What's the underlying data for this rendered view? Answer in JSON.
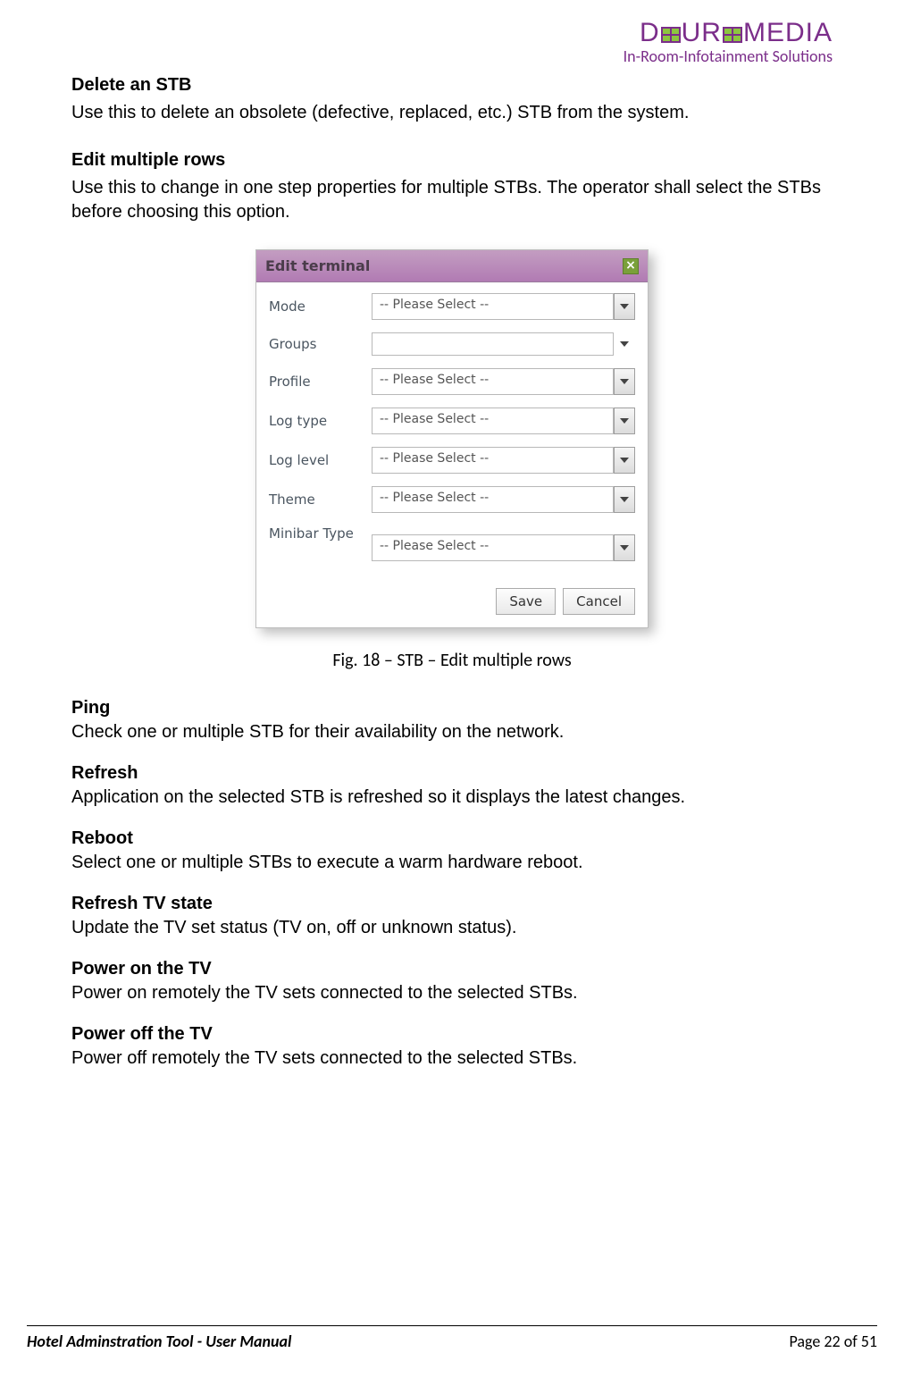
{
  "brand": {
    "name_1": "D",
    "name_2": "UR",
    "name_3": "MEDIA",
    "tagline": "In-Room-Infotainment Solutions"
  },
  "sections_top": [
    {
      "heading": "Delete an STB",
      "body": "Use this to delete an obsolete (defective, replaced, etc.) STB from the system."
    },
    {
      "heading": "Edit multiple rows",
      "body": "Use this to change in one step properties for multiple STBs. The operator shall select the STBs before choosing this option."
    }
  ],
  "dialog": {
    "title": "Edit terminal",
    "close_glyph": "×",
    "rows": [
      {
        "label": "Mode",
        "value": "-- Please Select --",
        "style": "select"
      },
      {
        "label": "Groups",
        "value": "",
        "style": "combo"
      },
      {
        "label": "Profile",
        "value": "-- Please Select --",
        "style": "select"
      },
      {
        "label": "Log type",
        "value": "-- Please Select --",
        "style": "select"
      },
      {
        "label": "Log level",
        "value": "-- Please Select --",
        "style": "select"
      },
      {
        "label": "Theme",
        "value": "-- Please Select --",
        "style": "select"
      },
      {
        "label": "Minibar Type",
        "value": "-- Please Select --",
        "style": "select",
        "tall": true
      }
    ],
    "save_label": "Save",
    "cancel_label": "Cancel"
  },
  "figure_caption": "Fig. 18 – STB – Edit multiple rows",
  "sections_bottom": [
    {
      "heading": "Ping",
      "body": "Check one or multiple STB for their availability on the network."
    },
    {
      "heading": "Refresh",
      "body": "Application on the selected STB is refreshed so it displays the latest changes."
    },
    {
      "heading": "Reboot",
      "body": "Select one or multiple STBs to execute a warm hardware reboot."
    },
    {
      "heading": "Refresh TV state",
      "body": "Update the TV set status (TV on, off or unknown status)."
    },
    {
      "heading": "Power on the TV",
      "body": "Power on remotely the TV sets connected to the selected STBs."
    },
    {
      "heading": "Power off the TV",
      "body": "Power off remotely the TV sets connected to the selected STBs."
    }
  ],
  "footer": {
    "left": "Hotel Adminstration Tool - User Manual",
    "right": "Page 22 of 51"
  }
}
